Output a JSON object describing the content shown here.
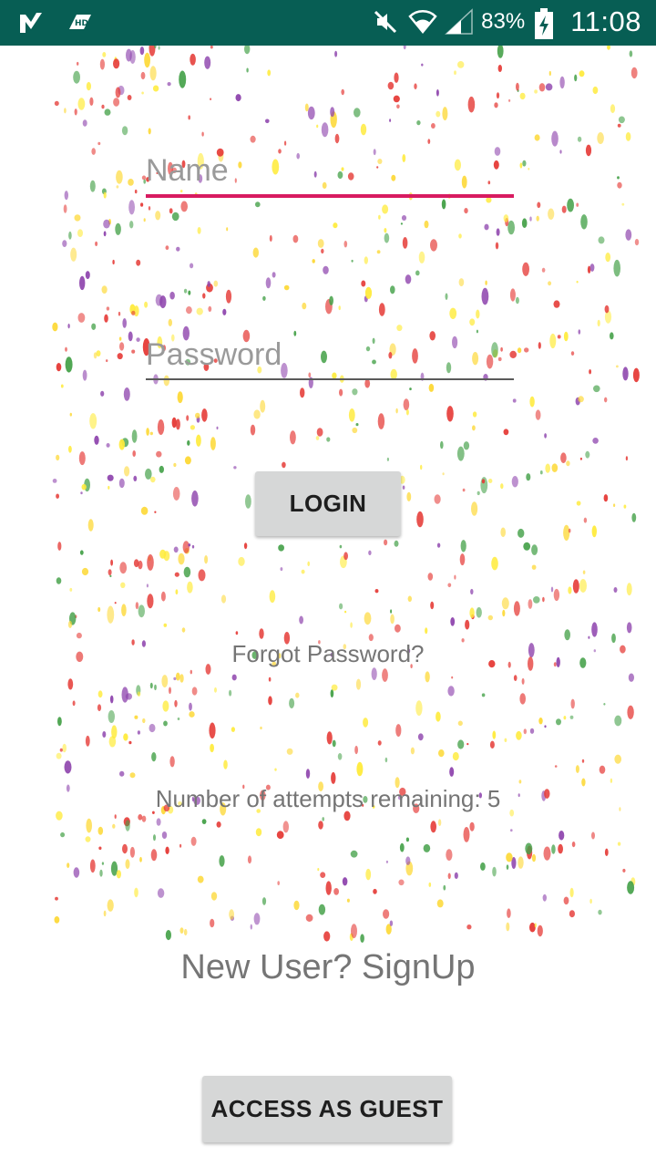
{
  "status_bar": {
    "battery_percent": "83%",
    "time": "11:08",
    "icons_left": [
      "check-notification-icon",
      "hd-icon"
    ],
    "icons_right": [
      "mute-icon",
      "wifi-icon",
      "signal-icon",
      "battery-charging-icon"
    ],
    "background_color": "#075e54"
  },
  "form": {
    "name_placeholder": "Name",
    "name_value": "",
    "password_placeholder": "Password",
    "password_value": "",
    "login_label": "LOGIN",
    "forgot_password": "Forgot Password?",
    "attempts_text": "Number of attempts remaining: 5",
    "signup_text": "New User? SignUp",
    "guest_label": "ACCESS AS GUEST"
  },
  "colors": {
    "accent": "#d81b60",
    "button": "#d6d7d7",
    "muted_text": "#757575"
  }
}
